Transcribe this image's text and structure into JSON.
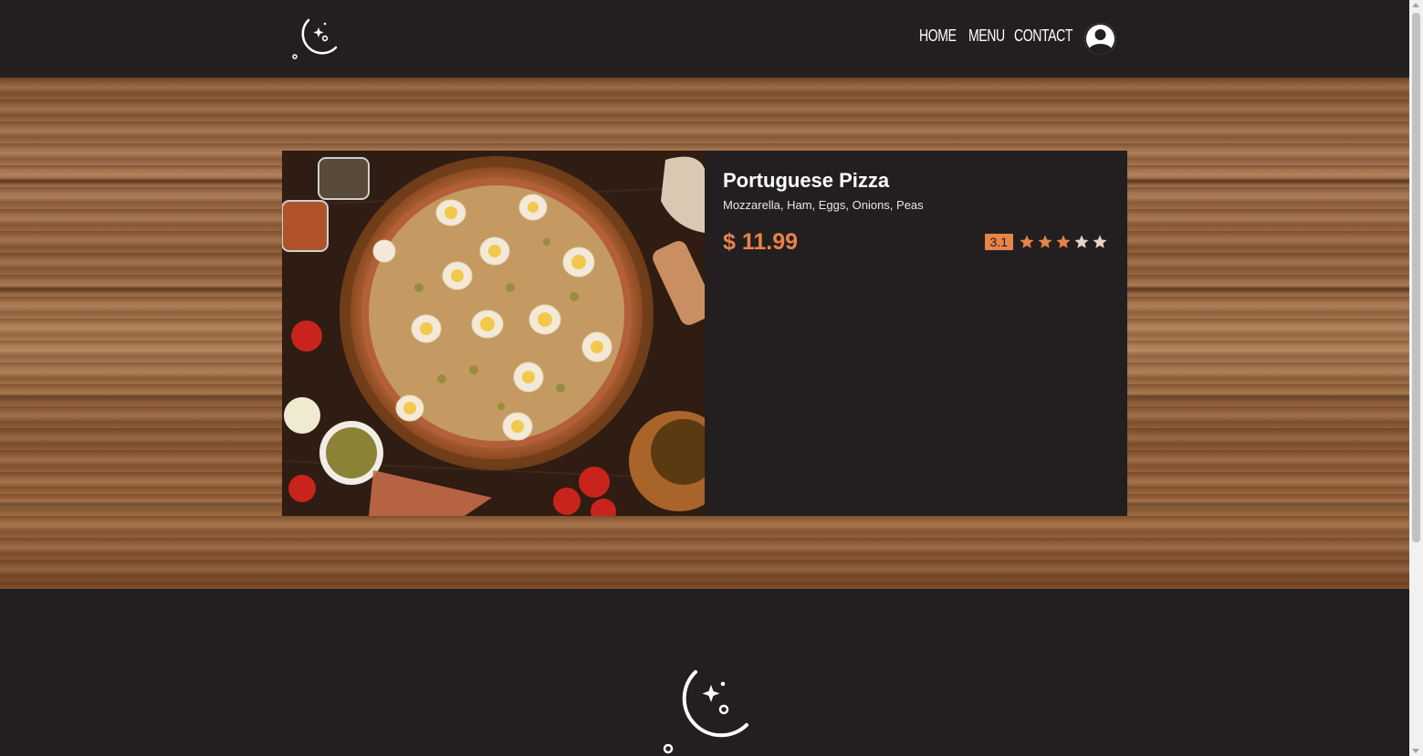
{
  "header": {
    "logo_icon": "moon-stars-icon",
    "nav": [
      {
        "label": "HOME"
      },
      {
        "label": "MENU"
      },
      {
        "label": "CONTACT"
      }
    ],
    "account_icon": "user-avatar-icon"
  },
  "product": {
    "image_icon": "pizza-photo",
    "name": "Portuguese Pizza",
    "ingredients": "Mozzarella, Ham, Eggs, Onions, Peas",
    "price": "$ 11.99",
    "rating": "3.1",
    "stars": 3,
    "max_stars": 5
  },
  "footer": {
    "logo_icon": "moon-stars-icon"
  },
  "colors": {
    "background": "#231f20",
    "accent": "#e8834a",
    "text": "#ffffff"
  }
}
